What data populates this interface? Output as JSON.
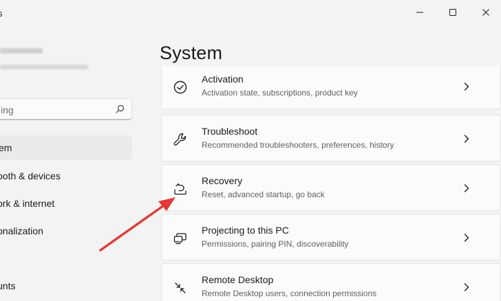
{
  "window": {
    "title_fragment": "s",
    "controls": {
      "minimize": "minimize-icon",
      "maximize": "maximize-icon",
      "close": "close-icon"
    }
  },
  "sidebar": {
    "search": {
      "value": "ing",
      "icon": "search-icon"
    },
    "nav_items": [
      {
        "label": "em",
        "selected": true
      },
      {
        "label": "ooth & devices",
        "selected": false
      },
      {
        "label": "ork & internet",
        "selected": false
      },
      {
        "label": "onalization",
        "selected": false
      },
      {
        "label": "unts",
        "selected": false
      }
    ]
  },
  "main": {
    "title": "System",
    "cards": [
      {
        "title": "Activation",
        "subtitle": "Activation state, subscriptions, product key",
        "icon": "activation-check-icon"
      },
      {
        "title": "Troubleshoot",
        "subtitle": "Recommended troubleshooters, preferences, history",
        "icon": "wrench-icon"
      },
      {
        "title": "Recovery",
        "subtitle": "Reset, advanced startup, go back",
        "icon": "recovery-icon"
      },
      {
        "title": "Projecting to this PC",
        "subtitle": "Permissions, pairing PIN, discoverability",
        "icon": "projector-icon"
      },
      {
        "title": "Remote Desktop",
        "subtitle": "Remote Desktop users, connection permissions",
        "icon": "remote-desktop-icon"
      }
    ]
  },
  "annotation": {
    "color": "#e53935",
    "icon": "red-arrow-annotation"
  }
}
